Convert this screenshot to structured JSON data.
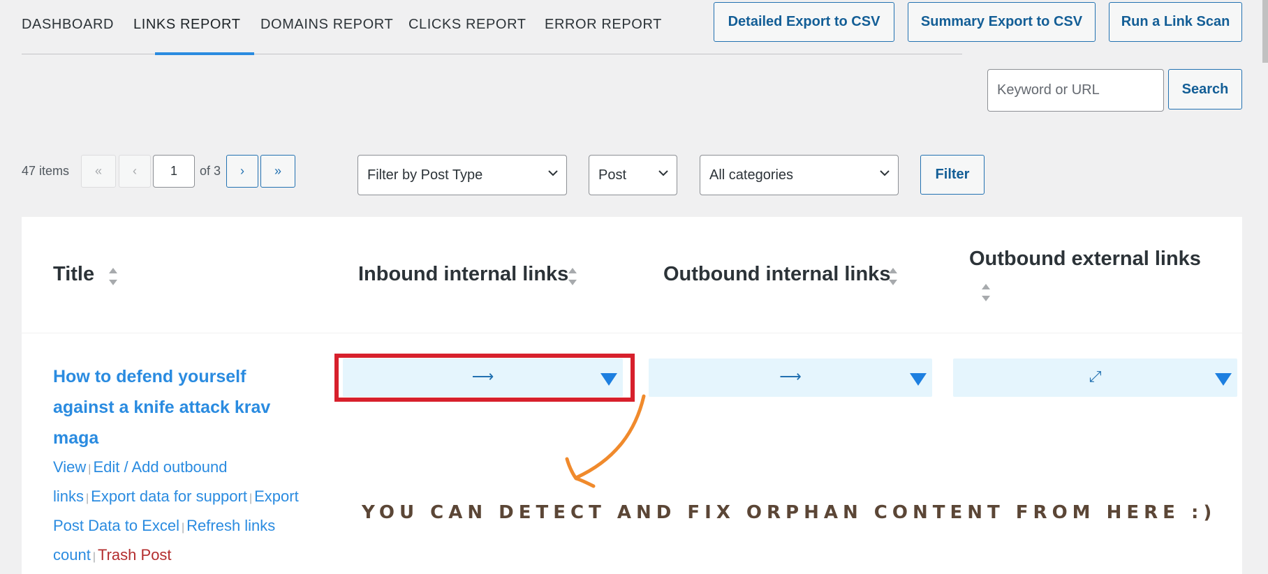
{
  "nav": {
    "tabs": [
      {
        "label": "DASHBOARD"
      },
      {
        "label": "LINKS REPORT"
      },
      {
        "label": "DOMAINS REPORT"
      },
      {
        "label": "CLICKS REPORT"
      },
      {
        "label": "ERROR REPORT"
      }
    ],
    "active_tab": "LINKS REPORT"
  },
  "toolbar": {
    "detailed_export": "Detailed Export to CSV",
    "summary_export": "Summary Export to CSV",
    "run_scan": "Run a Link Scan"
  },
  "search": {
    "placeholder": "Keyword or URL",
    "button": "Search"
  },
  "pagination": {
    "items_count": "47 items",
    "first": "«",
    "prev": "‹",
    "current_page": "1",
    "of_pages": "of 3",
    "next": "›",
    "last": "»"
  },
  "filters": {
    "post_type": "Filter by Post Type",
    "post": "Post",
    "categories": "All categories",
    "button": "Filter"
  },
  "table": {
    "columns": [
      {
        "label": "Title"
      },
      {
        "label": "Inbound internal links"
      },
      {
        "label": "Outbound internal links"
      },
      {
        "label": "Outbound external links"
      }
    ],
    "rows": [
      {
        "title": "How to defend yourself against a knife attack krav maga",
        "actions": {
          "view": "View",
          "edit": "Edit / Add outbound links",
          "export_support": "Export data for support",
          "export_excel": "Export Post Data to Excel",
          "refresh": "Refresh links count",
          "trash": "Trash Post"
        },
        "separator": "|",
        "inbound_icon": "⟶",
        "outbound_internal_icon": "⟶",
        "outbound_external_icon": "⤢"
      }
    ]
  },
  "annotation": {
    "text": "YOU CAN DETECT AND FIX ORPHAN CONTENT FROM HERE :)"
  },
  "colors": {
    "accent": "#2a8be0",
    "highlight": "#d7202c",
    "annotation_arrow": "#f08a2c",
    "link_bar": "#e5f5fd"
  }
}
